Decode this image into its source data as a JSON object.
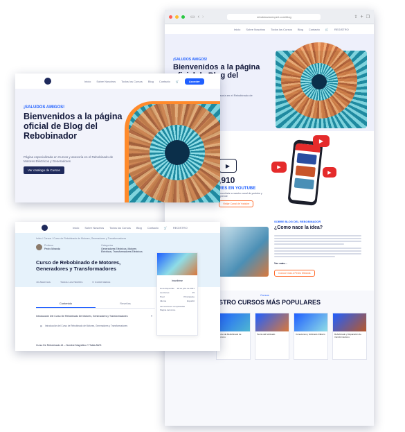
{
  "nav": {
    "home": "Inicio",
    "about": "Sobre Nosotros",
    "courses": "Todos los Cursos",
    "blog": "Blog",
    "contact": "Contacto",
    "button": "Acceder",
    "register": "REGISTRO"
  },
  "back_window": {
    "url": "rebobinadorexpert.com/blog",
    "greeting": "¡SALUDOS AMIGOS!",
    "heading": "Bienvenidos a la página oficial de Blog del Rebobinador",
    "sub": "Página especializada en Cursos y asesoría en el Rebobinado de Motores",
    "youtube_count": ",910",
    "youtube_label": "RES EN YOUTUBE",
    "youtube_sub": "Suscríbete a nuestro canal de youtube y aprende",
    "youtube_btn": "Visitar Canal de Youtube",
    "about_label": "SOBRE BLOG DEL REBOBINADOR",
    "about_title": "¿Como nace la idea?",
    "read_more": "Ver más...",
    "about_btn": "Conoce más a Pedro Miranda",
    "courses_label": "Cursos",
    "courses_title": "ESTRO CURSOS MÁS POPULARES",
    "course_titles": [
      "Curso de Rebobinado de Motores",
      "Teoría del bobinado",
      "Conexiones y bobinado trifásico",
      "Rebobinado y Reparación de transformadores"
    ]
  },
  "hero_card": {
    "greeting": "¡SALUDOS AMIGOS!",
    "heading": "Bienvenidos a la página oficial de Blog del Rebobinador",
    "sub": "Página especializada en Cursos y asesoría en el Rebobinado de Motores Eléctricos y Generadores",
    "cta": "Ver catalogo de Cursos"
  },
  "course_card": {
    "breadcrumb": "Inicio / Cursos / Curso de Rebobinado de Motores, Generadores y Transformadores",
    "instructor_label": "Profesor",
    "instructor": "Pedro Miranda",
    "category_label": "Categorías",
    "categories": "Generadores Eléctricos, Motores Eléctricos, Transformadores Eléctricos",
    "title": "Curso de Rebobinado de Motores, Generadores y Transformadores",
    "stat_students": "10 Alumnos",
    "stat_reviews": "0 Comentarios",
    "stat_level": "Todos Los Niveles",
    "tab_content": "Contenido",
    "tab_reviews": "Reseñas",
    "sidebar_btn": "Inscribirse",
    "sidebar_rows": [
      "Hora disponible",
      "Lecciones",
      "Nivel",
      "Idioma"
    ],
    "sidebar_values": [
      "28 de julio de 2021",
      "35",
      "Principiante",
      "Español"
    ],
    "sidebar_extra": "Las lecciones completadas",
    "sidebar_extra2": "Página del curso",
    "lesson1": "Introducción Del Curso De Rebobinado De Motores, Generadores y Transformadores",
    "lesson1a": "Introducción del Curso de Rebobinado de Motores, Generadores y Transformadores",
    "lesson2": "Curso De Rebobinado #1 – Nombre Magnético Y Tabla AWG"
  }
}
